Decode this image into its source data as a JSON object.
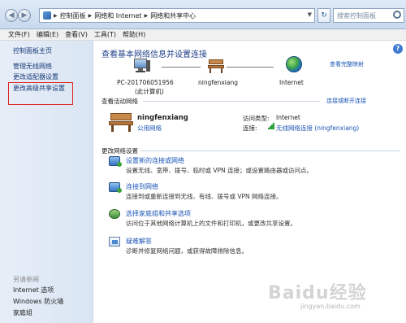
{
  "address_bar": {
    "crumbs": [
      "控制面板",
      "网络和 Internet",
      "网络和共享中心"
    ],
    "search_placeholder": "搜索控制面板"
  },
  "menu": [
    "文件(F)",
    "编辑(E)",
    "查看(V)",
    "工具(T)",
    "帮助(H)"
  ],
  "sidebar": {
    "home": "控制面板主页",
    "items": [
      "管理无线网络",
      "更改适配器设置",
      "更改高级共享设置"
    ],
    "see_also_title": "另请参阅",
    "see_also": [
      "Internet 选项",
      "Windows 防火墙",
      "家庭组"
    ]
  },
  "main": {
    "title": "查看基本网络信息并设置连接",
    "full_map_link": "查看完整映射",
    "map": {
      "pc_name": "PC-201706051956",
      "pc_sub": "(此计算机)",
      "network": "ningfenxiang",
      "internet": "Internet"
    },
    "active": {
      "heading": "查看活动网络",
      "connect_link": "连接或断开连接",
      "name": "ningfenxiang",
      "type": "公用网络",
      "access_label": "访问类型:",
      "access_value": "Internet",
      "conn_label": "连接:",
      "conn_value": "无线网络连接 (ningfenxiang)"
    },
    "change": {
      "heading": "更改网络设置",
      "tasks": [
        {
          "title": "设置新的连接或网络",
          "desc": "设置无线、宽带、拨号、临时或 VPN 连接；或设置路由器或访问点。",
          "icon": "network-setup-icon"
        },
        {
          "title": "连接到网络",
          "desc": "连接到或重新连接到无线、有线、拨号或 VPN 网络连接。",
          "icon": "connect-network-icon"
        },
        {
          "title": "选择家庭组和共享选项",
          "desc": "访问位于其他网络计算机上的文件和打印机，或更改共享设置。",
          "icon": "homegroup-icon"
        },
        {
          "title": "疑难解答",
          "desc": "诊断并修复网络问题，或获得故障排除信息。",
          "icon": "troubleshoot-icon"
        }
      ]
    }
  },
  "watermark": {
    "main": "Baidu经验",
    "sub": "jingyan.baidu.com"
  },
  "colors": {
    "link": "#1a55b4",
    "title": "#1f3f88",
    "highlight_box": "#e02020"
  }
}
